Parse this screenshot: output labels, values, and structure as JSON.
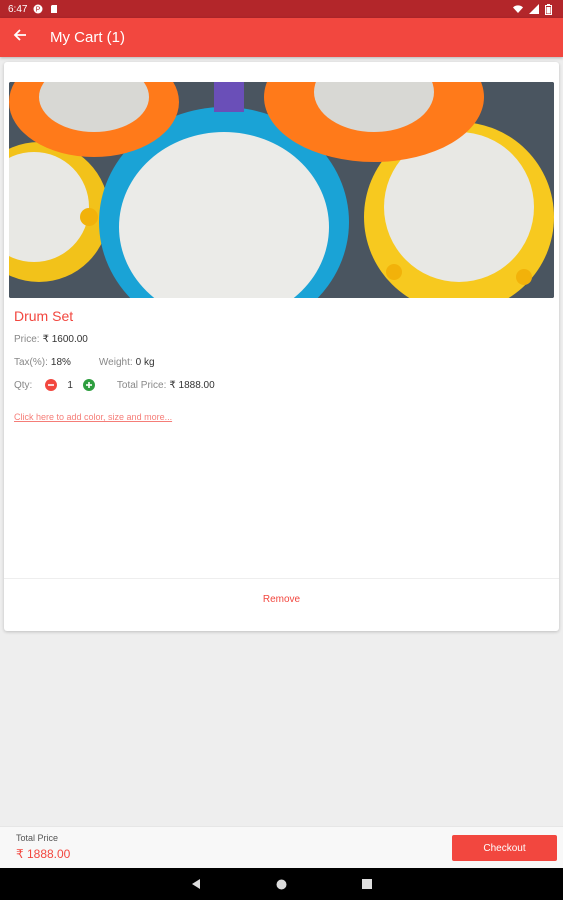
{
  "status_bar": {
    "time": "6:47"
  },
  "app_bar": {
    "title": "My Cart (1)"
  },
  "product": {
    "name": "Drum Set",
    "price_label": "Price:",
    "price_value": "₹ 1600.00",
    "tax_label": "Tax(%):",
    "tax_value": "18%",
    "weight_label": "Weight:",
    "weight_value": "0 kg",
    "qty_label": "Qty:",
    "qty_value": "1",
    "total_label": "Total Price:",
    "total_value": "₹ 1888.00",
    "options_link": "Click here to add color, size and more...",
    "remove_label": "Remove"
  },
  "footer": {
    "total_label": "Total Price",
    "total_value": "₹ 1888.00",
    "checkout_label": "Checkout"
  },
  "colors": {
    "primary": "#f2473f",
    "status_bar": "#b3262a",
    "plus": "#2e9e3f"
  }
}
